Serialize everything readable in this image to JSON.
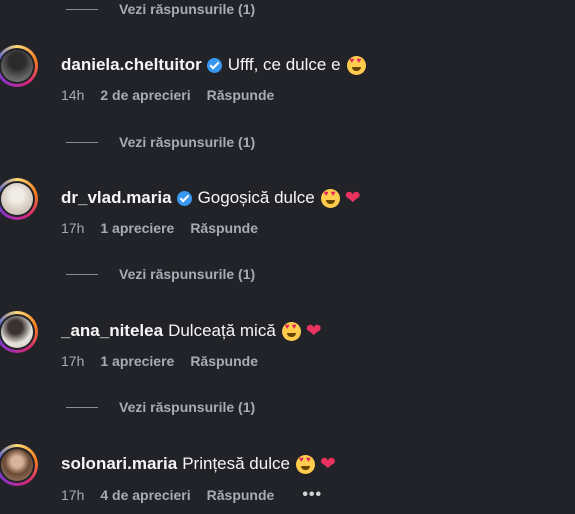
{
  "view_replies_label": "Vezi răspunsurile (1)",
  "comments": [
    {
      "username": "daniela.cheltuitor",
      "verified": true,
      "text": "Ufff, ce dulce e",
      "emojis": [
        "heart-eyes"
      ],
      "time": "14h",
      "likes": "2 de aprecieri",
      "reply_label": "Răspunde"
    },
    {
      "username": "dr_vlad.maria",
      "verified": true,
      "text": "Gogoșică dulce",
      "emojis": [
        "heart-eyes",
        "heart"
      ],
      "time": "17h",
      "likes": "1 apreciere",
      "reply_label": "Răspunde"
    },
    {
      "username": "_ana_nitelea",
      "verified": false,
      "text": "Dulceață mică",
      "emojis": [
        "heart-eyes",
        "heart"
      ],
      "time": "17h",
      "likes": "1 apreciere",
      "reply_label": "Răspunde"
    },
    {
      "username": "solonari.maria",
      "verified": false,
      "text": "Prințesă dulce",
      "emojis": [
        "heart-eyes",
        "heart"
      ],
      "time": "17h",
      "likes": "4 de aprecieri",
      "reply_label": "Răspunde",
      "more_label": "•••"
    }
  ],
  "colors": {
    "background": "#212328",
    "verified_badge": "#3897f0",
    "muted_text": "#a8abb1",
    "heart": "#e9325f"
  }
}
